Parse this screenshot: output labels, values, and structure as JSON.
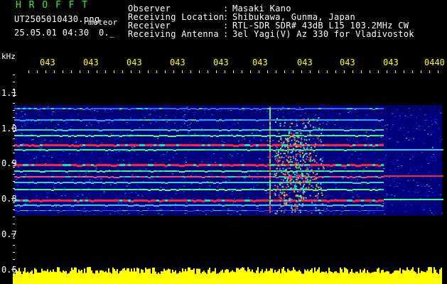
{
  "header": {
    "logo": "H R O F F T",
    "filename": "UT2505010430.png",
    "tag": "meteor",
    "datetime": "25.05.01 04:30",
    "marker": "0._",
    "info_labels": [
      "Observer",
      "Receiving Location",
      "Receiver",
      "Receiving Antenna"
    ],
    "info_colons": [
      ":",
      ":",
      ":",
      ":"
    ],
    "info_values": [
      "Masaki Kano",
      "Shibukawa, Gunma, Japan",
      "RTL-SDR SDR# 43dB L15 103.2MHz CW",
      "3el Yagi(V) Az 330 for Vladivostok"
    ]
  },
  "axis": {
    "unit": "kHz",
    "y_ticks": [
      "1.1",
      "1.0",
      "0.9",
      "0.8",
      "0.7",
      "0.6"
    ],
    "x_ticks": [
      "043",
      "043",
      "043",
      "043",
      "043",
      "043",
      "043",
      "043",
      "043",
      "0440"
    ]
  },
  "colors": {
    "label_white": "#ffffff",
    "logo_green": "#33ee33",
    "tick_yellow": "#ffff00",
    "noise_yellow": "#ffff00",
    "background": "#000000",
    "low_blue": "#0000aa",
    "band_red": "#ff2040"
  }
}
